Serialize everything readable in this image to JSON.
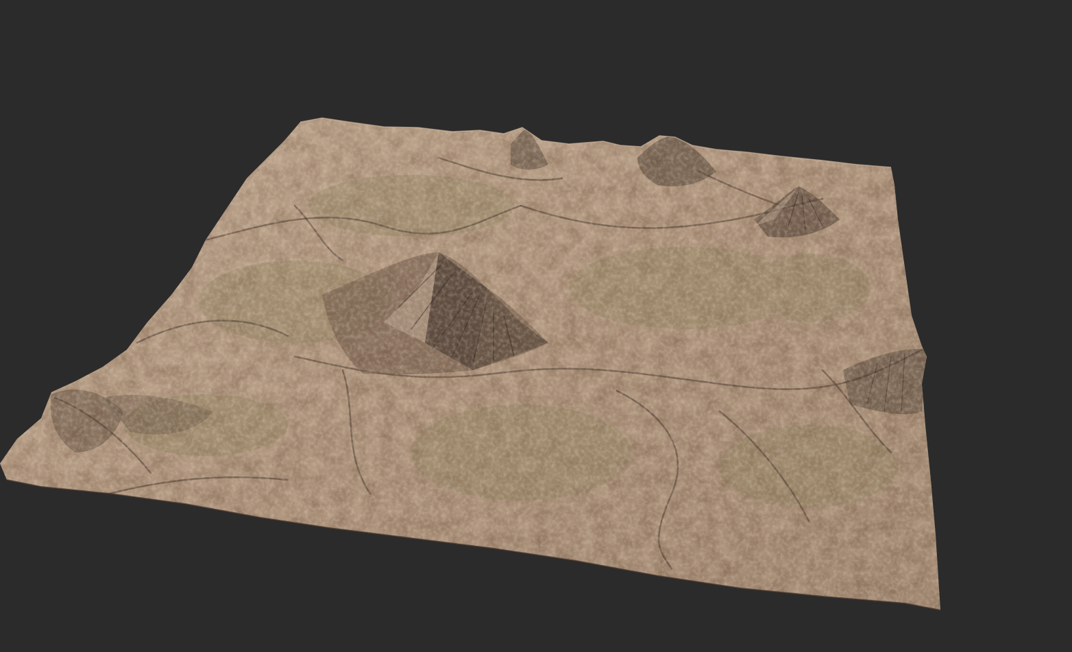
{
  "viewport": {
    "background_color": "#2b2b2b"
  },
  "terrain": {
    "colors": {
      "base": "#b39a82",
      "highlight": "#d4bca6",
      "shadow": "#5c4a3c",
      "vegetation": "#8a7e5a",
      "deep_shadow": "#3e3129"
    },
    "features": [
      "mountain-peak",
      "mountain-peak",
      "mountain-peak",
      "ridge",
      "valley",
      "plateau"
    ]
  }
}
